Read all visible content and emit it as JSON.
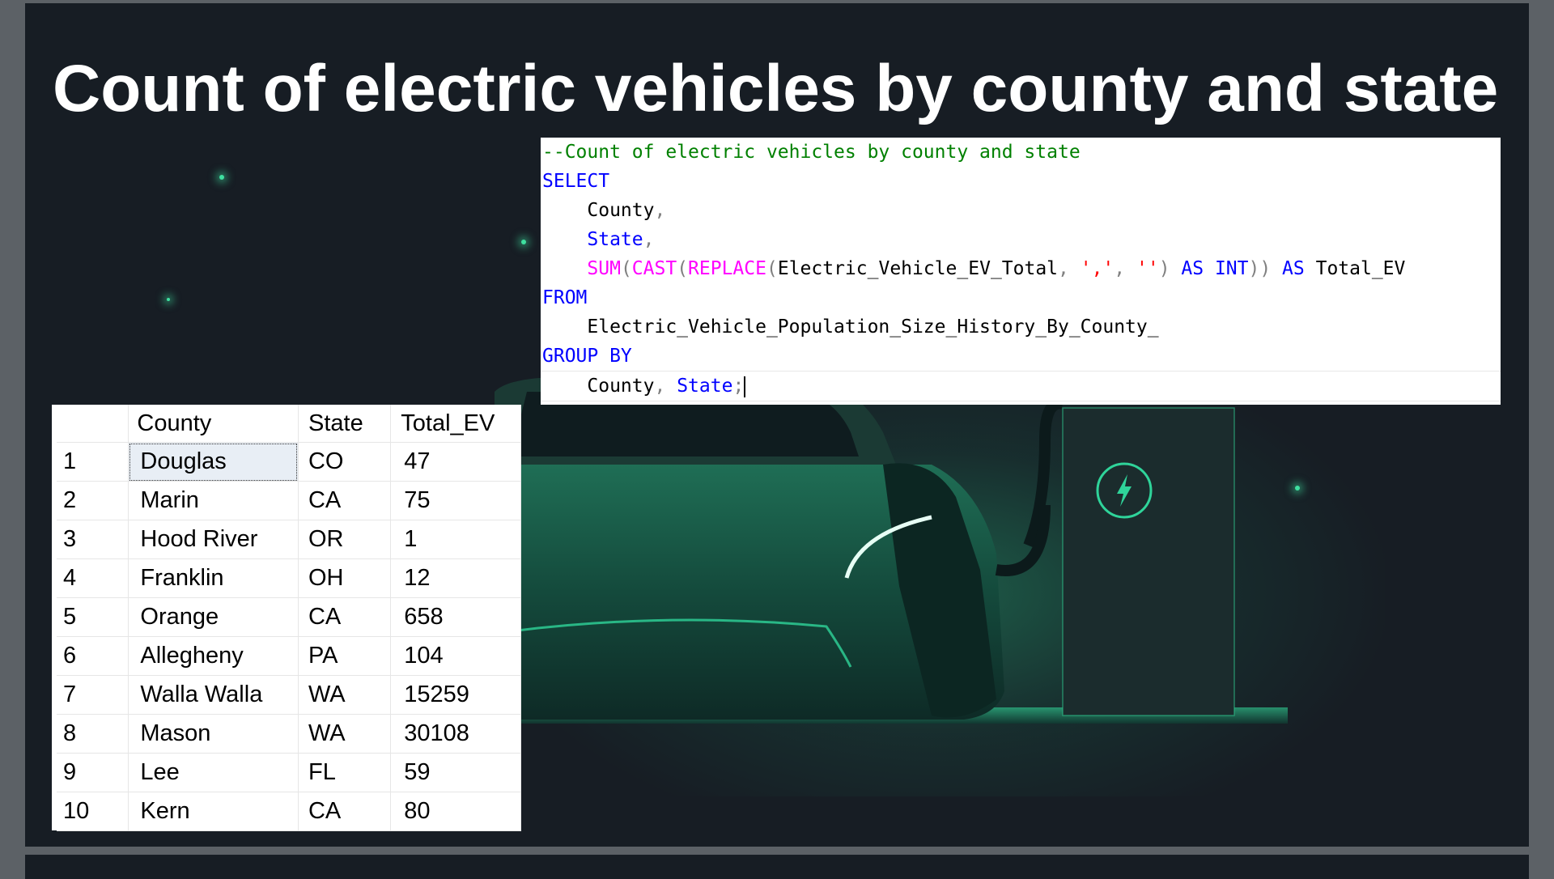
{
  "slide": {
    "title": "Count of electric vehicles by county and state"
  },
  "editor": {
    "lines": [
      [
        {
          "t": "--Count of electric vehicles by county and state",
          "c": "c"
        }
      ],
      [
        {
          "t": "SELECT",
          "c": "k"
        }
      ],
      [
        {
          "t": "    County",
          "c": ""
        },
        {
          "t": ",",
          "c": "g"
        }
      ],
      [
        {
          "t": "    ",
          "c": ""
        },
        {
          "t": "State",
          "c": "k"
        },
        {
          "t": ",",
          "c": "g"
        }
      ],
      [
        {
          "t": "    ",
          "c": ""
        },
        {
          "t": "SUM",
          "c": "f"
        },
        {
          "t": "(",
          "c": "g"
        },
        {
          "t": "CAST",
          "c": "f"
        },
        {
          "t": "(",
          "c": "g"
        },
        {
          "t": "REPLACE",
          "c": "f"
        },
        {
          "t": "(",
          "c": "g"
        },
        {
          "t": "Electric_Vehicle_EV_Total",
          "c": ""
        },
        {
          "t": ", ",
          "c": "g"
        },
        {
          "t": "','",
          "c": "s"
        },
        {
          "t": ", ",
          "c": "g"
        },
        {
          "t": "''",
          "c": "s"
        },
        {
          "t": ") ",
          "c": "g"
        },
        {
          "t": "AS",
          "c": "k"
        },
        {
          "t": " ",
          "c": ""
        },
        {
          "t": "INT",
          "c": "k"
        },
        {
          "t": ")) ",
          "c": "g"
        },
        {
          "t": "AS",
          "c": "k"
        },
        {
          "t": " Total_EV",
          "c": ""
        }
      ],
      [
        {
          "t": "FROM",
          "c": "k"
        }
      ],
      [
        {
          "t": "    Electric_Vehicle_Population_Size_History_By_County_",
          "c": ""
        }
      ],
      [
        {
          "t": "GROUP BY",
          "c": "k"
        }
      ],
      [
        {
          "t": "    County",
          "c": ""
        },
        {
          "t": ", ",
          "c": "g"
        },
        {
          "t": "State",
          "c": "k"
        },
        {
          "t": ";",
          "c": "g"
        }
      ]
    ]
  },
  "results": {
    "headers": [
      "",
      "County",
      "State",
      "Total_EV"
    ],
    "rows": [
      [
        "1",
        "Douglas",
        "CO",
        "47"
      ],
      [
        "2",
        "Marin",
        "CA",
        "75"
      ],
      [
        "3",
        "Hood River",
        "OR",
        "1"
      ],
      [
        "4",
        "Franklin",
        "OH",
        "12"
      ],
      [
        "5",
        "Orange",
        "CA",
        "658"
      ],
      [
        "6",
        "Allegheny",
        "PA",
        "104"
      ],
      [
        "7",
        "Walla Walla",
        "WA",
        "15259"
      ],
      [
        "8",
        "Mason",
        "WA",
        "30108"
      ],
      [
        "9",
        "Lee",
        "FL",
        "59"
      ],
      [
        "10",
        "Kern",
        "CA",
        "80"
      ]
    ]
  },
  "colors": {
    "background": "#171d24",
    "accent_glow": "#3fe0a0",
    "sql_keyword": "#0000ff",
    "sql_function": "#ff00ff",
    "sql_comment": "#008000",
    "sql_string": "#ff0000"
  },
  "icons": [
    "lightning-bolt-icon"
  ]
}
